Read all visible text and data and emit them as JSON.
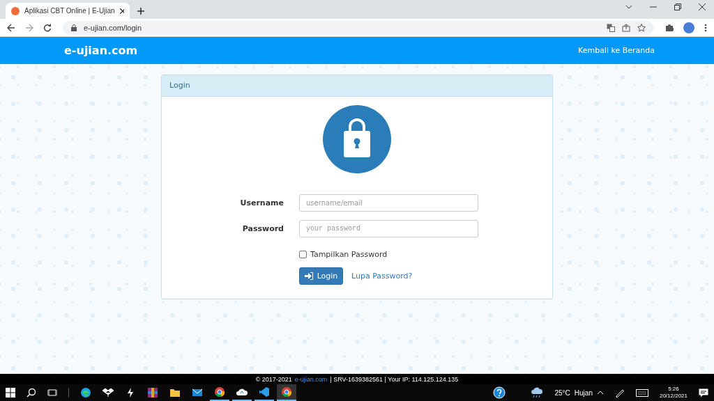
{
  "browser": {
    "tabs": [
      {
        "title": "Aplikasi CBT Online | E-Ujian",
        "selected": true
      }
    ],
    "address": "e-ujian.com/login"
  },
  "header": {
    "logo": "e-ujian.com",
    "nav_link": "Kembali ke Beranda"
  },
  "login_panel": {
    "title": "Login",
    "fields": [
      {
        "label": "Username",
        "placeholder": "username/email",
        "kind": "text"
      },
      {
        "label": "Password",
        "placeholder": "your password",
        "kind": "password"
      }
    ],
    "show_password": {
      "label": "Tampilkan Password",
      "checked": false
    },
    "submit": "Login",
    "forgot_link": "Lupa Password?"
  },
  "footer": {
    "prefix": "© 2017-2021",
    "link": "e-ujian.com",
    "info": "| SRV-1639382561 | Your IP: 114.125.124.135"
  },
  "taskbar": {
    "temperature": "25°C",
    "weather": "Hujan",
    "time": "5:26",
    "date": "20/12/2021"
  }
}
